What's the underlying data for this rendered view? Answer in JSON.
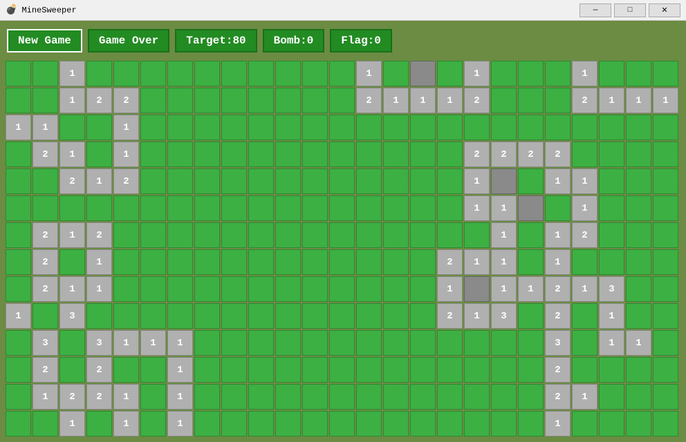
{
  "titleBar": {
    "icon": "💣",
    "title": "MineSweeper",
    "minimize": "—",
    "maximize": "□",
    "close": "✕"
  },
  "toolbar": {
    "newGame": "New Game",
    "gameOver": "Game Over",
    "target": "Target:80",
    "bomb": "Bomb:0",
    "flag": "Flag:0"
  },
  "grid": {
    "rows": 14,
    "cols": 25,
    "cells": [
      "g",
      "g",
      "1",
      "g",
      "g",
      "g",
      "g",
      "g",
      "g",
      "g",
      "g",
      "g",
      "g",
      "1",
      "g",
      "d",
      "g",
      "1",
      "g",
      "g",
      "g",
      "1",
      "g",
      "g",
      "g",
      "g",
      "g",
      "1",
      "2",
      "2",
      "g",
      "g",
      "g",
      "g",
      "g",
      "g",
      "g",
      "g",
      "2",
      "1",
      "1",
      "1",
      "2",
      "g",
      "g",
      "g",
      "2",
      "1",
      "1",
      "1",
      "1",
      "1",
      "g",
      "g",
      "1",
      "g",
      "g",
      "g",
      "g",
      "g",
      "g",
      "g",
      "g",
      "g",
      "g",
      "g",
      "g",
      "g",
      "g",
      "g",
      "g",
      "g",
      "g",
      "g",
      "g",
      "g",
      "2",
      "1",
      "g",
      "1",
      "g",
      "g",
      "g",
      "g",
      "g",
      "g",
      "g",
      "g",
      "g",
      "g",
      "g",
      "g",
      "2",
      "2",
      "2",
      "2",
      "g",
      "g",
      "g",
      "g",
      "g",
      "g",
      "2",
      "1",
      "2",
      "g",
      "g",
      "g",
      "g",
      "g",
      "g",
      "g",
      "g",
      "g",
      "g",
      "g",
      "g",
      "1",
      "d",
      "g",
      "1",
      "1",
      "g",
      "g",
      "g",
      "g",
      "g",
      "g",
      "g",
      "g",
      "g",
      "g",
      "g",
      "g",
      "g",
      "g",
      "g",
      "g",
      "g",
      "g",
      "g",
      "g",
      "1",
      "1",
      "d",
      "g",
      "1",
      "g",
      "g",
      "g",
      "g",
      "2",
      "1",
      "2",
      "g",
      "g",
      "g",
      "g",
      "g",
      "g",
      "g",
      "g",
      "g",
      "g",
      "g",
      "g",
      "g",
      "g",
      "1",
      "g",
      "1",
      "2",
      "g",
      "g",
      "g",
      "g",
      "2",
      "g",
      "1",
      "g",
      "g",
      "g",
      "g",
      "g",
      "g",
      "g",
      "g",
      "g",
      "g",
      "g",
      "g",
      "2",
      "1",
      "1",
      "g",
      "1",
      "g",
      "g",
      "g",
      "g",
      "g",
      "2",
      "1",
      "1",
      "g",
      "g",
      "g",
      "g",
      "g",
      "g",
      "g",
      "g",
      "g",
      "g",
      "g",
      "g",
      "1",
      "d",
      "1",
      "1",
      "2",
      "1",
      "3",
      "g",
      "g",
      "1",
      "g",
      "3",
      "g",
      "g",
      "g",
      "g",
      "g",
      "g",
      "g",
      "g",
      "g",
      "g",
      "g",
      "g",
      "g",
      "2",
      "1",
      "3",
      "g",
      "2",
      "g",
      "1",
      "g",
      "g",
      "g",
      "3",
      "g",
      "3",
      "1",
      "1",
      "1",
      "g",
      "g",
      "g",
      "g",
      "g",
      "g",
      "g",
      "g",
      "g",
      "g",
      "g",
      "g",
      "g",
      "3",
      "g",
      "1",
      "1",
      "g",
      "g",
      "2",
      "g",
      "2",
      "g",
      "g",
      "1",
      "g",
      "g",
      "g",
      "g",
      "g",
      "g",
      "g",
      "g",
      "g",
      "g",
      "g",
      "g",
      "g",
      "2",
      "g",
      "g",
      "g",
      "g",
      "g",
      "1",
      "2",
      "2",
      "1",
      "g",
      "1",
      "g",
      "g",
      "g",
      "g",
      "g",
      "g",
      "g",
      "g",
      "g",
      "g",
      "g",
      "g",
      "g",
      "2",
      "1",
      "g",
      "g",
      "g",
      "g",
      "g",
      "1",
      "g",
      "1",
      "g",
      "1",
      "g",
      "g",
      "g",
      "g",
      "g",
      "g",
      "g",
      "g",
      "g",
      "g",
      "g",
      "g",
      "g",
      "1",
      "g",
      "g",
      "g",
      "g"
    ]
  }
}
